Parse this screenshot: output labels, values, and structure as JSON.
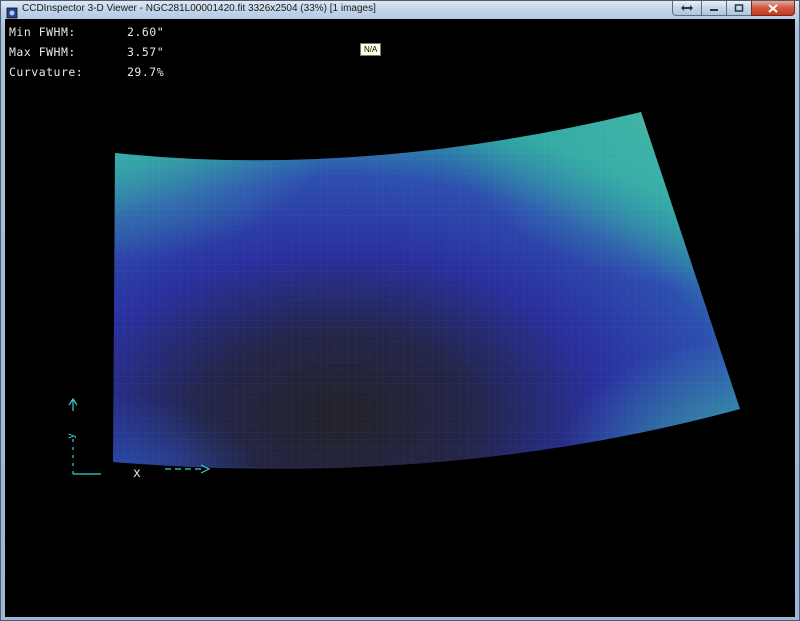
{
  "window": {
    "title": "CCDInspector 3-D Viewer - NGC281L00001420.fit 3326x2504 (33%)  [1 images]"
  },
  "stats": {
    "min_fwhm": {
      "label": "Min FWHM:",
      "value": "2.60\""
    },
    "max_fwhm": {
      "label": "Max FWHM:",
      "value": "3.57\""
    },
    "curvature": {
      "label": "Curvature:",
      "value": "29.7%"
    }
  },
  "tooltip": {
    "text": "N/A"
  },
  "axes": {
    "x_label": "x",
    "y_label": "y"
  },
  "colors": {
    "surface_low": "#1f1f24",
    "surface_mid": "#2a2fa8",
    "surface_teal": "#2fa9a0",
    "surface_high": "#f08a8a",
    "axis": "#3fcfd0"
  }
}
